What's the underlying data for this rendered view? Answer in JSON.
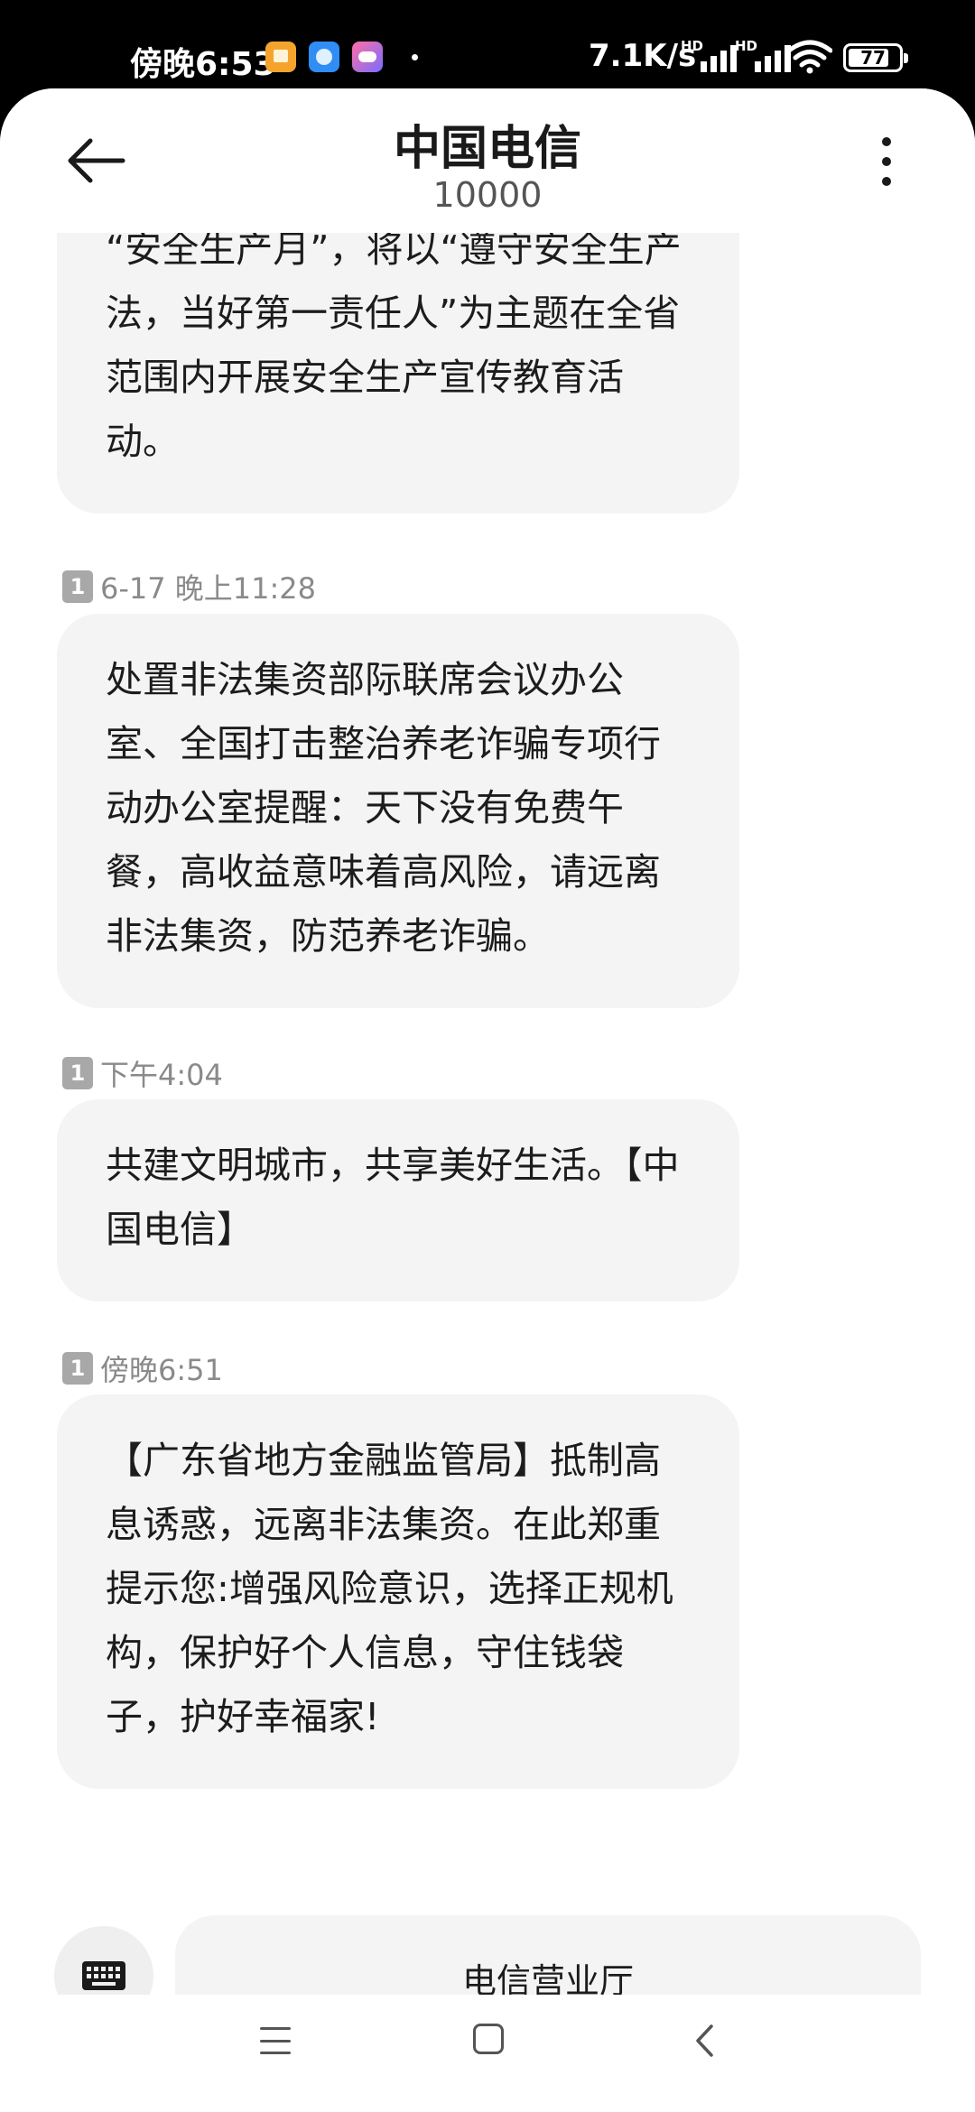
{
  "status_bar": {
    "time": "傍晚6:53",
    "network_speed": "7.1K/s",
    "signal_label": "HD",
    "battery": "77"
  },
  "header": {
    "title": "中国电信",
    "number": "10000"
  },
  "messages": [
    {
      "time": "",
      "text": "“安全生产月”，将以“遵守安全生产法，当好第一责任人”为主题在全省范围内开展安全生产宣传教育活动。"
    },
    {
      "sim": "1",
      "time": "6-17 晚上11:28",
      "text": "处置非法集资部际联席会议办公室、全国打击整治养老诈骗专项行动办公室提醒：天下没有免费午餐，高收益意味着高风险，请远离非法集资，防范养老诈骗。"
    },
    {
      "sim": "1",
      "time": "下午4:04",
      "text": "共建文明城市，共享美好生活。【中国电信】"
    },
    {
      "sim": "1",
      "time": "傍晚6:51",
      "text": "【广东省地方金融监管局】抵制高息诱惑，远离非法集资。在此郑重提示您:增强风险意识，选择正规机构，保护好个人信息，守住钱袋子，护好幸福家!"
    }
  ],
  "bottom": {
    "quick_reply": "电信营业厅"
  },
  "icons": {
    "back": "arrow-left-icon",
    "more": "more-vertical-icon",
    "keyboard": "keyboard-icon",
    "nav_menu": "menu-icon",
    "nav_home": "home-icon",
    "nav_back": "chevron-left-icon"
  },
  "colors": {
    "bubble": "#f4f4f4",
    "meta": "#8a8a8a",
    "sim_badge": "#a8a8a8"
  }
}
